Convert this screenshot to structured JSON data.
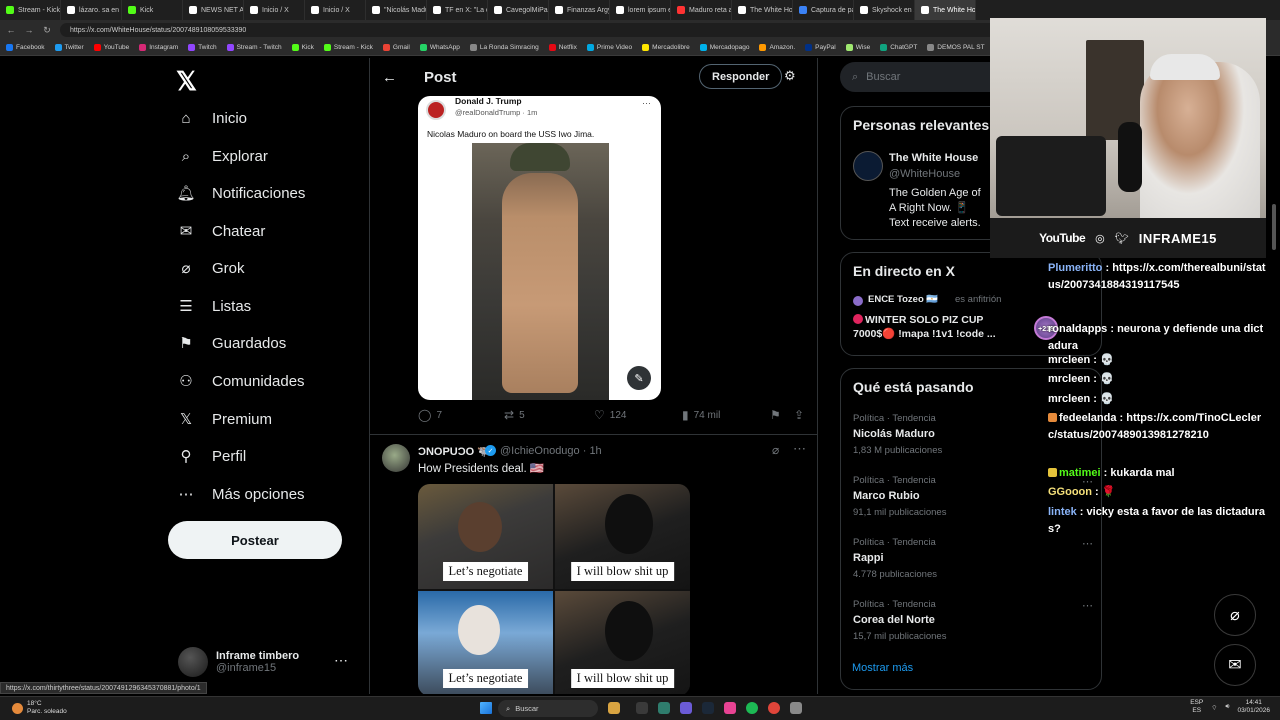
{
  "browser": {
    "tabs": [
      {
        "label": "Stream - Kick D",
        "color": "#53fc18",
        "active": false
      },
      {
        "label": "lázaro. sa en X",
        "color": "#ffffff",
        "active": false
      },
      {
        "label": "Kick",
        "color": "#53fc18",
        "active": false
      },
      {
        "label": "NEWS NET APP",
        "color": "#ffffff",
        "active": false
      },
      {
        "label": "Inicio / X",
        "color": "#ffffff",
        "active": false
      },
      {
        "label": "Inicio / X",
        "color": "#ffffff",
        "active": false
      },
      {
        "label": "\"Nicolás Maduro",
        "color": "#ffffff",
        "active": false
      },
      {
        "label": "TF en X: \"La del",
        "color": "#ffffff",
        "active": false
      },
      {
        "label": "CavegolMiPasto",
        "color": "#ffffff",
        "active": false
      },
      {
        "label": "Finanzas Argy e",
        "color": "#ffffff",
        "active": false
      },
      {
        "label": "lorem ipsum en",
        "color": "#ffffff",
        "active": false
      },
      {
        "label": "Maduro reta a",
        "color": "#ff3333",
        "active": false
      },
      {
        "label": "The White Hous",
        "color": "#ffffff",
        "active": false
      },
      {
        "label": "Captura de pant",
        "color": "#3b82f6",
        "active": false
      },
      {
        "label": "Skyshock en X",
        "color": "#ffffff",
        "active": false
      },
      {
        "label": "The White Hous",
        "color": "#ffffff",
        "active": true
      }
    ],
    "url": "https://x.com/WhiteHouse/status/2007489108059533390",
    "bookmarks": [
      {
        "label": "Facebook",
        "color": "#1877f2"
      },
      {
        "label": "Twitter",
        "color": "#1d9bf0"
      },
      {
        "label": "YouTube",
        "color": "#ff0000"
      },
      {
        "label": "Instagram",
        "color": "#d62976"
      },
      {
        "label": "Twitch",
        "color": "#9146ff"
      },
      {
        "label": "Stream - Twitch",
        "color": "#9146ff"
      },
      {
        "label": "Kick",
        "color": "#53fc18"
      },
      {
        "label": "Stream - Kick",
        "color": "#53fc18"
      },
      {
        "label": "Gmail",
        "color": "#ea4335"
      },
      {
        "label": "WhatsApp",
        "color": "#25d366"
      },
      {
        "label": "La Ronda Simracing",
        "color": "#888888"
      },
      {
        "label": "Netflix",
        "color": "#e50914"
      },
      {
        "label": "Prime Video",
        "color": "#00a8e1"
      },
      {
        "label": "Mercadolibre",
        "color": "#ffe600"
      },
      {
        "label": "Mercadopago",
        "color": "#00b1ea"
      },
      {
        "label": "Amazon.",
        "color": "#ff9900"
      },
      {
        "label": "PayPal",
        "color": "#003087"
      },
      {
        "label": "Wise",
        "color": "#9fe870"
      },
      {
        "label": "ChatGPT",
        "color": "#10a37f"
      },
      {
        "label": "DEMOS PAL ST",
        "color": "#888888"
      }
    ],
    "status_url": "https://x.com/thirtythree/status/2007491296345370881/photo/1"
  },
  "nav": {
    "items": [
      {
        "label": "Inicio",
        "icon": "home-icon",
        "glyph": "⌂"
      },
      {
        "label": "Explorar",
        "icon": "search-icon",
        "glyph": "⌕"
      },
      {
        "label": "Notificaciones",
        "icon": "bell-icon",
        "glyph": "🔔︎"
      },
      {
        "label": "Chatear",
        "icon": "mail-icon",
        "glyph": "✉"
      },
      {
        "label": "Grok",
        "icon": "grok-icon",
        "glyph": "⌀"
      },
      {
        "label": "Listas",
        "icon": "list-icon",
        "glyph": "☰"
      },
      {
        "label": "Guardados",
        "icon": "bookmark-icon",
        "glyph": "⚑"
      },
      {
        "label": "Comunidades",
        "icon": "communities-icon",
        "glyph": "⚇"
      },
      {
        "label": "Premium",
        "icon": "x-premium-icon",
        "glyph": "𝕏"
      },
      {
        "label": "Perfil",
        "icon": "profile-icon",
        "glyph": "⚲"
      },
      {
        "label": "Más opciones",
        "icon": "more-options-icon",
        "glyph": "⋯"
      }
    ],
    "post_button": "Postear",
    "account": {
      "name": "Inframe timbero",
      "handle": "@inframe15"
    }
  },
  "post": {
    "header_title": "Post",
    "reply_button": "Responder",
    "quoted": {
      "name": "Donald J. Trump",
      "handle": "@realDonaldTrump · 1m",
      "text": "Nicolas Maduro on board the USS Iwo Jima."
    },
    "actions": {
      "replies": "7",
      "reposts": "5",
      "likes": "124",
      "views": "74 mil"
    }
  },
  "tweet2": {
    "name": "ƆNOPUƆO 🐃",
    "handle": "@IchieOnodugo · 1h",
    "text": "How Presidents deal. 🇺🇸",
    "captions": [
      "Let’s negotiate",
      "I will blow shit up",
      "Let’s negotiate",
      "I will blow shit up"
    ]
  },
  "sidebar": {
    "search_placeholder": "Buscar",
    "relevant_title": "Personas relevantes",
    "relevant_person": {
      "name": "The White House",
      "handle": "@WhiteHouse",
      "bio": "The Golden Age of A Right Now. 📱 Text receive alerts."
    },
    "live_title": "En directo en X",
    "live": {
      "host": "ENCE Tozeo 🇦🇷",
      "host_role": "es anfitrión",
      "title": "WINTER SOLO PIZ CUP 7000$🔴 !mapa !1v1 !code ..."
    },
    "trends_title": "Qué está pasando",
    "trends": [
      {
        "category": "Política · Tendencia",
        "name": "Nicolás Maduro",
        "count": "1,83 M publicaciones"
      },
      {
        "category": "Política · Tendencia",
        "name": "Marco Rubio",
        "count": "91,1 mil publicaciones"
      },
      {
        "category": "Política · Tendencia",
        "name": "Rappi",
        "count": "4.778 publicaciones"
      },
      {
        "category": "Política · Tendencia",
        "name": "Corea del Norte",
        "count": "15,7 mil publicaciones"
      }
    ],
    "show_more": "Mostrar más"
  },
  "stream": {
    "platform": "YouTube",
    "handle": "INFRAME15",
    "chat": [
      {
        "user": "Plumeritto",
        "text": "https://x.com/therealbuni/status/2007341884319117545",
        "color": "#8ab4f8",
        "badge": ""
      },
      {
        "user": "ronaldapps",
        "text": "neurona y defiende una dictadura",
        "color": "#ffffff",
        "badge": ""
      },
      {
        "user": "mrcleen",
        "text": "💀",
        "color": "#ffffff",
        "badge": ""
      },
      {
        "user": "mrcleen",
        "text": "💀",
        "color": "#ffffff",
        "badge": ""
      },
      {
        "user": "mrcleen",
        "text": "💀",
        "color": "#ffffff",
        "badge": ""
      },
      {
        "user": "fedeelanda",
        "text": "https://x.com/TinoCLeclerc/status/2007489013981278210",
        "color": "#ffffff",
        "badge": "#e58a3b"
      },
      {
        "user": "matimei",
        "text": "kukarda mal",
        "color": "#53fc18",
        "badge": "#e5c33b"
      },
      {
        "user": "GGooon",
        "text": "🌹",
        "color": "#f5e07a",
        "badge": ""
      },
      {
        "user": "lintek",
        "text": "vicky esta a favor de las dictaduras?",
        "color": "#8ab4f8",
        "badge": ""
      }
    ],
    "sub_badge": "+218"
  },
  "taskbar": {
    "weather_temp": "18°C",
    "weather_desc": "Parc. soleado",
    "search": "Buscar",
    "lang": "ESP",
    "lang_sub": "ES",
    "time": "14:41",
    "date": "03/01/2026"
  }
}
